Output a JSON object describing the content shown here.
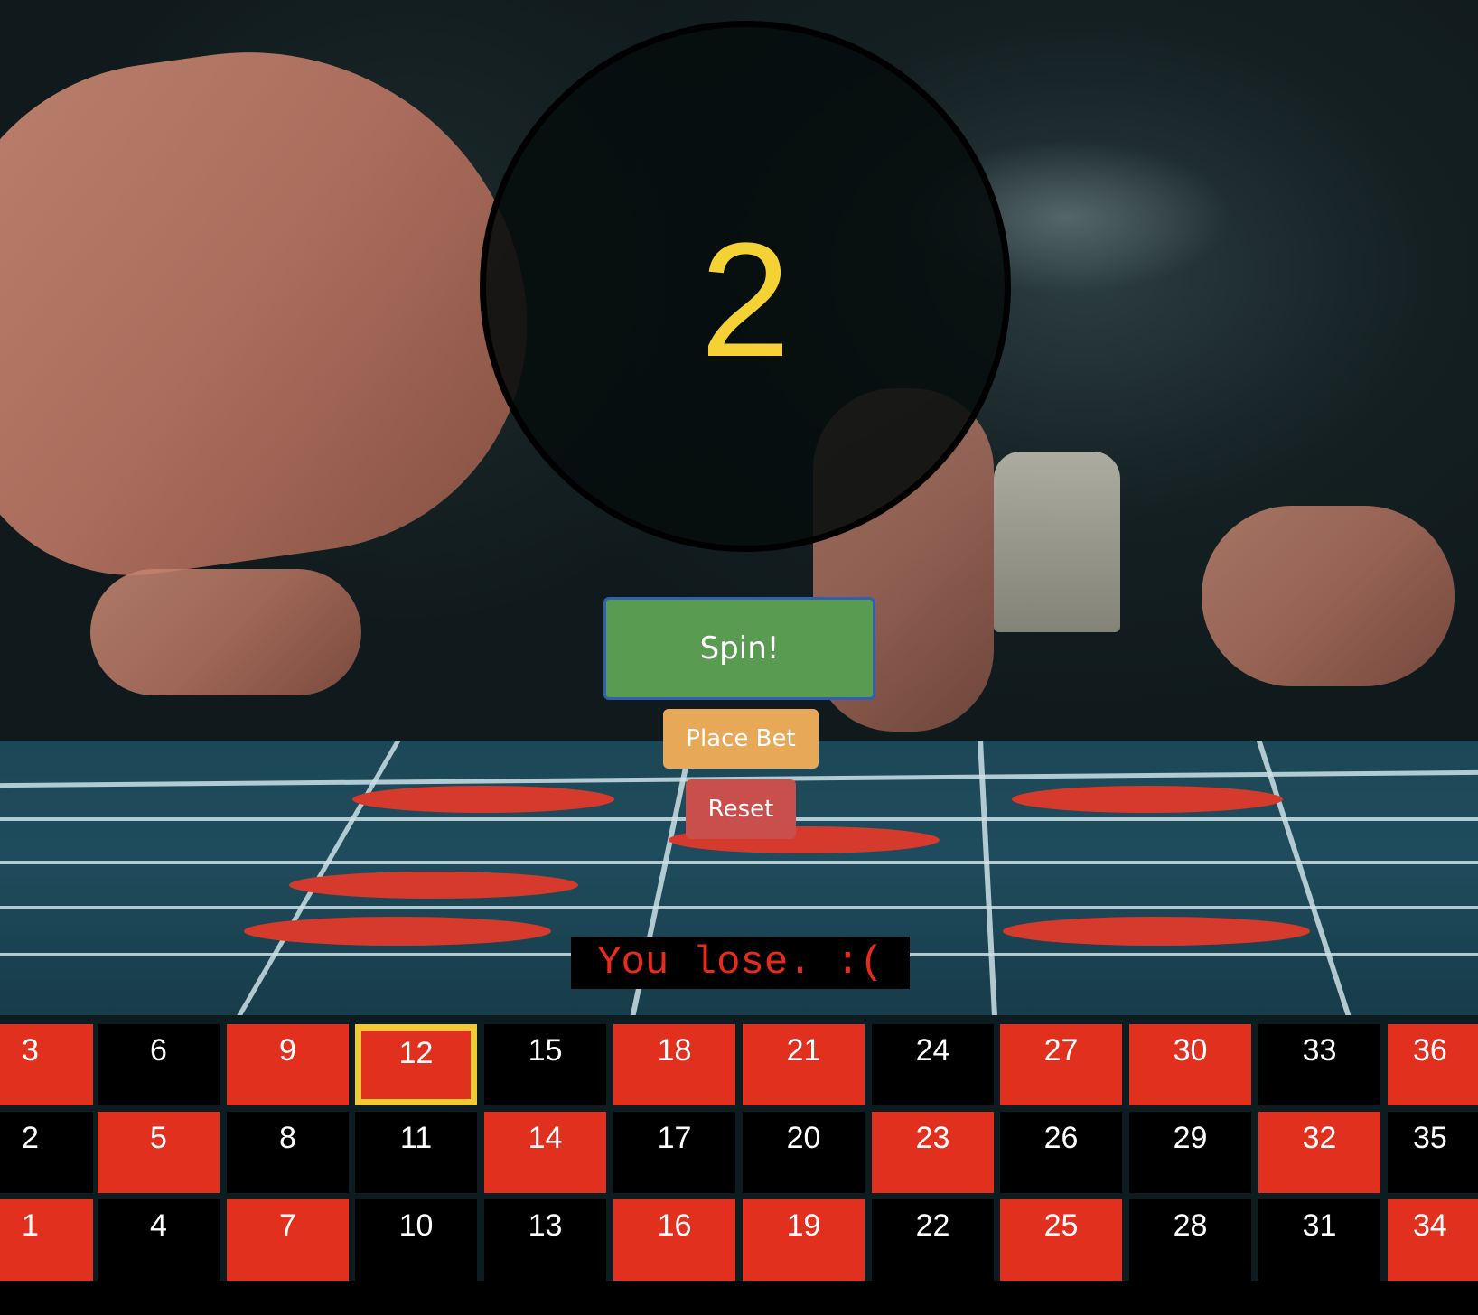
{
  "result": {
    "number": "2"
  },
  "controls": {
    "spin_label": "Spin!",
    "place_bet_label": "Place Bet",
    "reset_label": "Reset"
  },
  "status": {
    "message": "You lose. :("
  },
  "board": {
    "selected": "12",
    "rows": [
      [
        {
          "n": "3",
          "color": "red"
        },
        {
          "n": "6",
          "color": "black"
        },
        {
          "n": "9",
          "color": "red"
        },
        {
          "n": "12",
          "color": "red"
        },
        {
          "n": "15",
          "color": "black"
        },
        {
          "n": "18",
          "color": "red"
        },
        {
          "n": "21",
          "color": "red"
        },
        {
          "n": "24",
          "color": "black"
        },
        {
          "n": "27",
          "color": "red"
        },
        {
          "n": "30",
          "color": "red"
        },
        {
          "n": "33",
          "color": "black"
        },
        {
          "n": "36",
          "color": "red"
        }
      ],
      [
        {
          "n": "2",
          "color": "black"
        },
        {
          "n": "5",
          "color": "red"
        },
        {
          "n": "8",
          "color": "black"
        },
        {
          "n": "11",
          "color": "black"
        },
        {
          "n": "14",
          "color": "red"
        },
        {
          "n": "17",
          "color": "black"
        },
        {
          "n": "20",
          "color": "black"
        },
        {
          "n": "23",
          "color": "red"
        },
        {
          "n": "26",
          "color": "black"
        },
        {
          "n": "29",
          "color": "black"
        },
        {
          "n": "32",
          "color": "red"
        },
        {
          "n": "35",
          "color": "black"
        }
      ],
      [
        {
          "n": "1",
          "color": "red"
        },
        {
          "n": "4",
          "color": "black"
        },
        {
          "n": "7",
          "color": "red"
        },
        {
          "n": "10",
          "color": "black"
        },
        {
          "n": "13",
          "color": "black"
        },
        {
          "n": "16",
          "color": "red"
        },
        {
          "n": "19",
          "color": "red"
        },
        {
          "n": "22",
          "color": "black"
        },
        {
          "n": "25",
          "color": "red"
        },
        {
          "n": "28",
          "color": "black"
        },
        {
          "n": "31",
          "color": "black"
        },
        {
          "n": "34",
          "color": "red"
        }
      ]
    ]
  },
  "colors": {
    "red": "#e2301f",
    "black": "#000000",
    "highlight": "#f1cb35",
    "result_text": "#f5d233"
  }
}
